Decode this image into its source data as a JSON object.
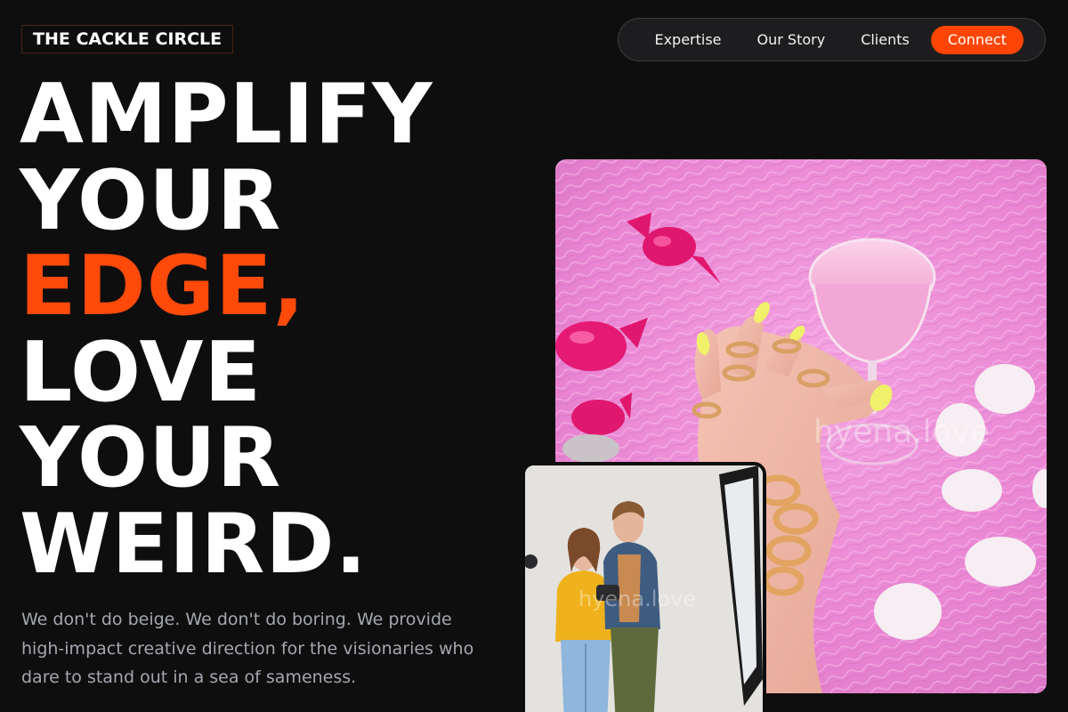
{
  "brand": {
    "name": "THE CACKLE CIRCLE"
  },
  "nav": {
    "links": [
      "Expertise",
      "Our Story",
      "Clients"
    ],
    "cta": "Connect"
  },
  "hero": {
    "lines": [
      "AMPLIFY",
      "YOUR",
      "EDGE,",
      "LOVE",
      "YOUR",
      "WEIRD."
    ],
    "accent_line_index": 2,
    "subtext": "We don't do beige. We don't do boring. We provide high-impact creative direction for the visionaries who dare to stand out in a sea of sameness."
  },
  "images": {
    "main": {
      "subject": "hand-with-rings-holding-pink-cocktail-on-pink-fur",
      "watermark": "hyena.love"
    },
    "secondary": {
      "subject": "two-people-reviewing-camera-in-studio",
      "watermark": "hyena.love"
    }
  },
  "colors": {
    "background": "#0e0e0f",
    "accent": "#ff4506",
    "nav_background": "#1d1d1f",
    "body_text": "#a4a7ae",
    "fur_pink": "#ee8ad6",
    "candy_magenta": "#e0176f",
    "nail_yellow": "#f0f06a"
  }
}
